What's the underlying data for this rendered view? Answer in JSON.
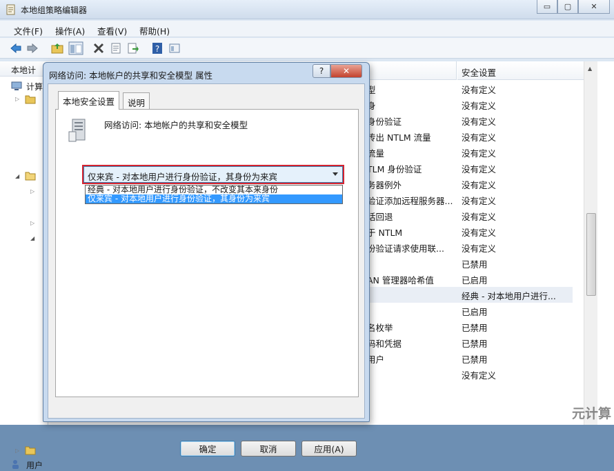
{
  "window": {
    "title": "本地组策略编辑器",
    "minimize": "▭",
    "maximize": "▢",
    "close": "✕"
  },
  "menu": [
    "文件(F)",
    "操作(A)",
    "查看(V)",
    "帮助(H)"
  ],
  "toolbar_icons": [
    "back-arrow-icon",
    "forward-arrow-icon",
    "up-folder-icon",
    "show-hide-tree-icon",
    "delete-icon",
    "properties-icon",
    "export-icon",
    "help-icon",
    "mmc-icon"
  ],
  "tree": {
    "header": "本地计",
    "items": [
      "计算",
      "用户"
    ]
  },
  "list": {
    "columns": [
      "",
      "安全设置"
    ],
    "rows": [
      {
        "policy": "型",
        "setting": "没有定义"
      },
      {
        "policy": "身",
        "setting": "没有定义"
      },
      {
        "policy": "身份验证",
        "setting": "没有定义"
      },
      {
        "policy": "传出 NTLM 流量",
        "setting": "没有定义"
      },
      {
        "policy": "流量",
        "setting": "没有定义"
      },
      {
        "policy": "TLM 身份验证",
        "setting": "没有定义"
      },
      {
        "policy": "务器例外",
        "setting": "没有定义"
      },
      {
        "policy": "验证添加远程服务器...",
        "setting": "没有定义"
      },
      {
        "policy": "话回退",
        "setting": "没有定义"
      },
      {
        "policy": "于 NTLM",
        "setting": "没有定义"
      },
      {
        "policy": "份验证请求使用联...",
        "setting": "没有定义"
      },
      {
        "policy": "",
        "setting": "已禁用"
      },
      {
        "policy": "AN 管理器哈希值",
        "setting": "已启用"
      },
      {
        "policy": "",
        "setting": "经典 - 对本地用户进行..."
      },
      {
        "policy": "",
        "setting": "已启用"
      },
      {
        "policy": "名枚举",
        "setting": "已禁用"
      },
      {
        "policy": "码和凭据",
        "setting": "已禁用"
      },
      {
        "policy": "用户",
        "setting": "已禁用"
      },
      {
        "policy": "",
        "setting": "没有定义"
      }
    ]
  },
  "dialog": {
    "title": "网络访问: 本地帐户的共享和安全模型 属性",
    "help": "?",
    "close": "✕",
    "tabs": [
      "本地安全设置",
      "说明"
    ],
    "policy_name": "网络访问: 本地帐户的共享和安全模型",
    "combo_value": "仅来宾 - 对本地用户进行身份验证，其身份为来宾",
    "options": [
      "经典 - 对本地用户进行身份验证，不改变其本来身份",
      "仅来宾 - 对本地用户进行身份验证，其身份为来宾"
    ],
    "buttons": {
      "ok": "确定",
      "cancel": "取消",
      "apply": "应用(A)"
    }
  },
  "watermark": "元计算"
}
